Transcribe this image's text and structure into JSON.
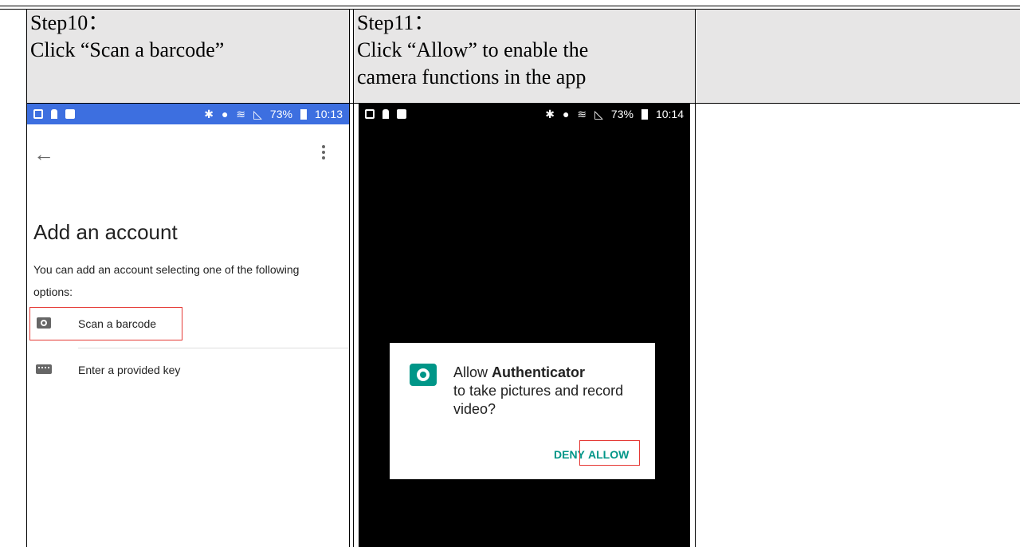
{
  "steps": [
    {
      "title": "Step10：",
      "desc": "Click “Scan a barcode”"
    },
    {
      "title": "Step11：",
      "desc_line1": "Click “Allow” to enable the",
      "desc_line2": "camera functions in the app"
    }
  ],
  "phone1": {
    "status_time": "10:13",
    "battery": "73%",
    "status_bar_color": "#3d6fe0",
    "page_title": "Add an account",
    "description": "You can add an account selecting one of the following options:",
    "options": [
      {
        "icon": "camera-icon",
        "label": "Scan a barcode"
      },
      {
        "icon": "keyboard-icon",
        "label": "Enter a provided key"
      }
    ]
  },
  "phone2": {
    "status_time": "10:14",
    "battery": "73%",
    "dialog": {
      "icon": "camera-icon",
      "prefix": "Allow ",
      "app_name": "Authenticator",
      "message": "to take pictures and record video?",
      "deny": "DENY",
      "allow": "ALLOW",
      "accent": "#009688"
    }
  },
  "highlight_color": "#e53935"
}
